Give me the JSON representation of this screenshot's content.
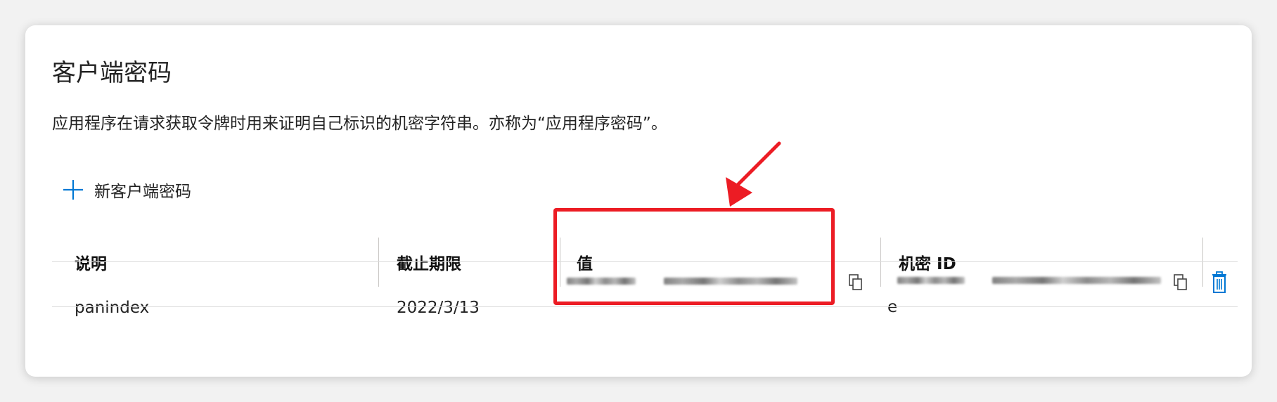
{
  "section": {
    "title": "客户端密码",
    "description": "应用程序在请求获取令牌时用来证明自己标识的机密字符串。亦称为“应用程序密码”。",
    "new_button_label": "新客户端密码"
  },
  "table": {
    "headers": {
      "description": "说明",
      "expires": "截止期限",
      "value": "值",
      "secret_id": "机密 ID"
    },
    "rows": [
      {
        "description": "panindex",
        "expires": "2022/3/13",
        "secret_id_prefix": "e"
      }
    ]
  },
  "colors": {
    "accent": "#0078d4",
    "annotation_red": "#ec1c24"
  },
  "icons": [
    "plus-icon",
    "copy-icon",
    "trash-icon"
  ]
}
